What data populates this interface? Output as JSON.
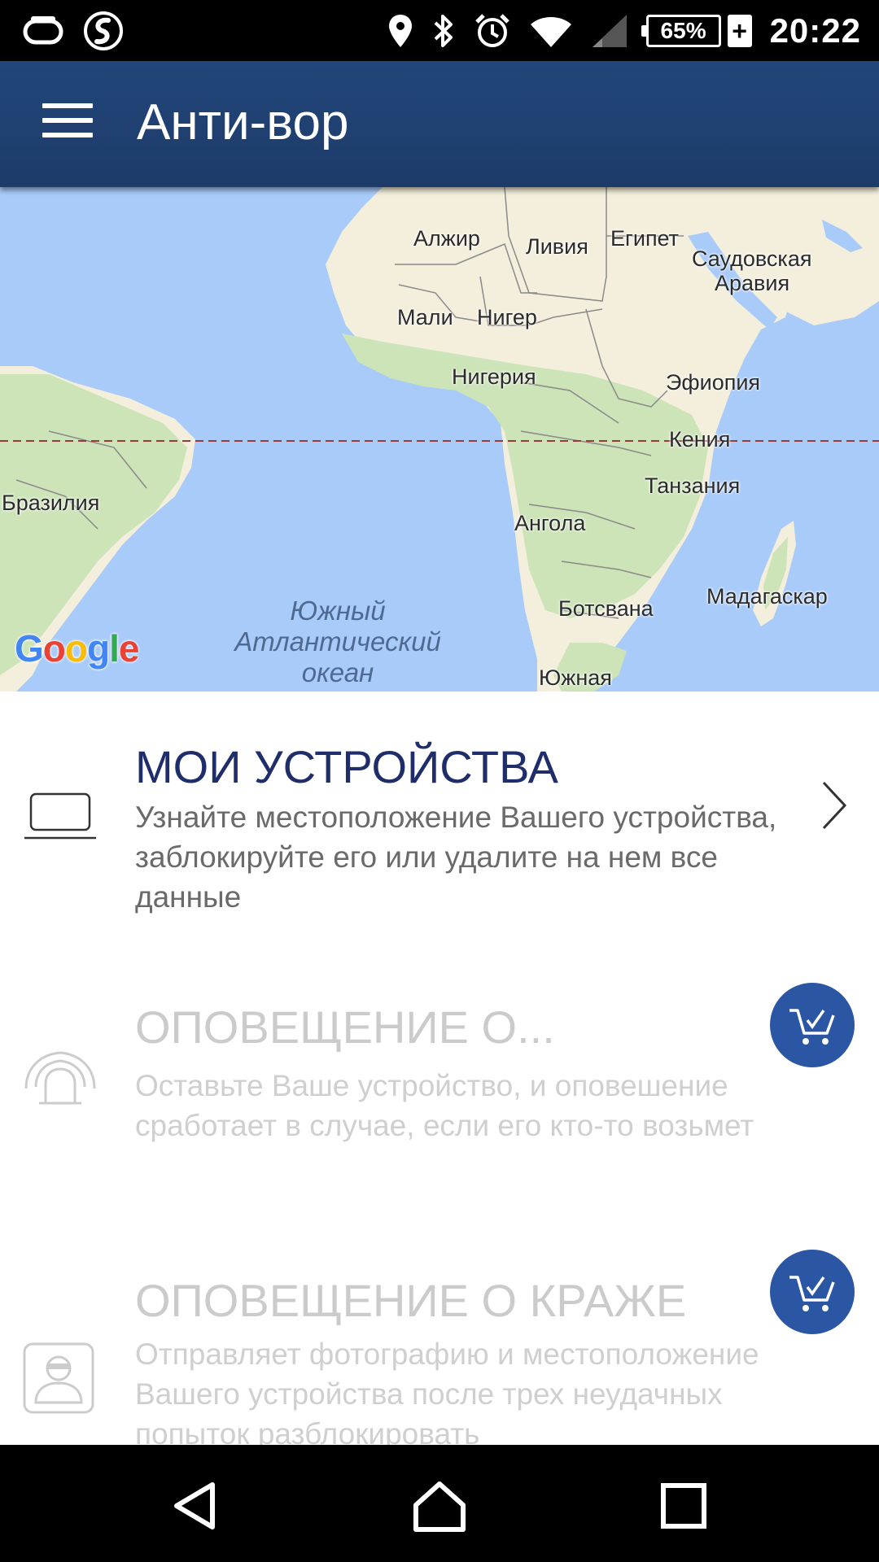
{
  "status_bar": {
    "time": "20:22",
    "battery": "65%",
    "charging_symbol": "+",
    "icons": [
      "sync-icon",
      "swype-icon",
      "location-icon",
      "bluetooth-icon",
      "alarm-icon",
      "wifi-icon",
      "cell-signal-icon"
    ]
  },
  "app_bar": {
    "title": "Анти-вор",
    "menu_icon": "hamburger-menu-icon",
    "background": "#1f3f6e"
  },
  "map": {
    "labels": {
      "algeria": "Алжир",
      "libya": "Ливия",
      "egypt": "Египет",
      "saudi_1": "Саудовская",
      "saudi_2": "Аравия",
      "mali": "Мали",
      "niger": "Нигер",
      "nigeria": "Нигерия",
      "ethiopia": "Эфиопия",
      "kenya": "Кения",
      "brazil": "Бразилия",
      "tanzania": "Танзания",
      "angola": "Ангола",
      "madagascar": "Мадагаскар",
      "botswana": "Ботсвана",
      "south_africa": "Южная",
      "ocean_1": "Южный",
      "ocean_2": "Атлантический",
      "ocean_3": "океан"
    },
    "google_logo": {
      "G": "G",
      "o1": "o",
      "o2": "o",
      "g": "g",
      "l": "l",
      "e": "e"
    },
    "colors": {
      "water": "#a9cbfa",
      "land": "#f3efdc",
      "vegetation": "#cde3b8",
      "equator": "#9a3a3a"
    }
  },
  "items": [
    {
      "title": "МОИ УСТРОЙСТВА",
      "description": "Узнайте местоположение Вашего устройства, заблокируйте его или удалите на нем все данные",
      "icon": "laptop-icon",
      "state": "active",
      "action_icon": "chevron-right-icon"
    },
    {
      "title": "ОПОВЕЩЕНИЕ О...",
      "description": "Оставьте Ваше устройство, и оповешение сработает в случае, если его кто-то возьмет",
      "icon": "alarm-siren-icon",
      "state": "locked",
      "action_icon": "shopping-cart-icon"
    },
    {
      "title": "ОПОВЕЩЕНИЕ О КРАЖЕ",
      "description": "Отправляет фотографию и местоположение Вашего устройства после трех неудачных попыток разблокировать",
      "icon": "thief-icon",
      "state": "locked",
      "action_icon": "shopping-cart-icon"
    }
  ],
  "nav_bar": {
    "icons": [
      "back-icon",
      "home-icon",
      "recents-icon"
    ]
  }
}
